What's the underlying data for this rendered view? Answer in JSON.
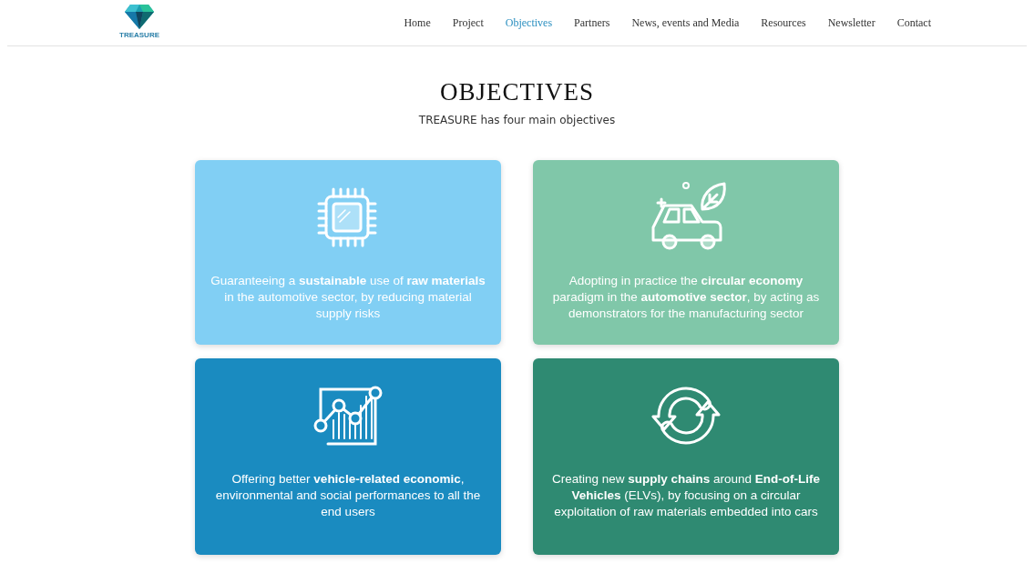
{
  "logo": {
    "text": "TREASURE"
  },
  "nav": [
    {
      "label": "Home",
      "selected": false
    },
    {
      "label": "Project",
      "selected": false
    },
    {
      "label": "Objectives",
      "selected": true
    },
    {
      "label": "Partners",
      "selected": false
    },
    {
      "label": "News, events and Media",
      "selected": false
    },
    {
      "label": "Resources",
      "selected": false
    },
    {
      "label": "Newsletter",
      "selected": false
    },
    {
      "label": "Contact",
      "selected": false
    }
  ],
  "heading": "OBJECTIVES",
  "subtitle": "TREASURE has four main objectives",
  "cards": [
    {
      "kind": "chip",
      "color": "#81cff4",
      "text": "Guaranteeing a **sustainable** use of **raw materials** in the automotive sector, by reducing material supply risks"
    },
    {
      "kind": "car",
      "color": "#80c7a9",
      "text": "Adopting in practice the **circular economy** paradigm in the **automotive sector**, by acting as demonstrators for the manufacturing sector"
    },
    {
      "kind": "chart",
      "color": "#1a8bc0",
      "text": "Offering better **vehicle-related economic**, environmental and social performances to all the end users"
    },
    {
      "kind": "cycle",
      "color": "#2f8a72",
      "text": "Creating new **supply chains** around **End-of-Life Vehicles** (ELVs), by focusing on a circular exploitation of raw materials embedded into cars"
    }
  ]
}
